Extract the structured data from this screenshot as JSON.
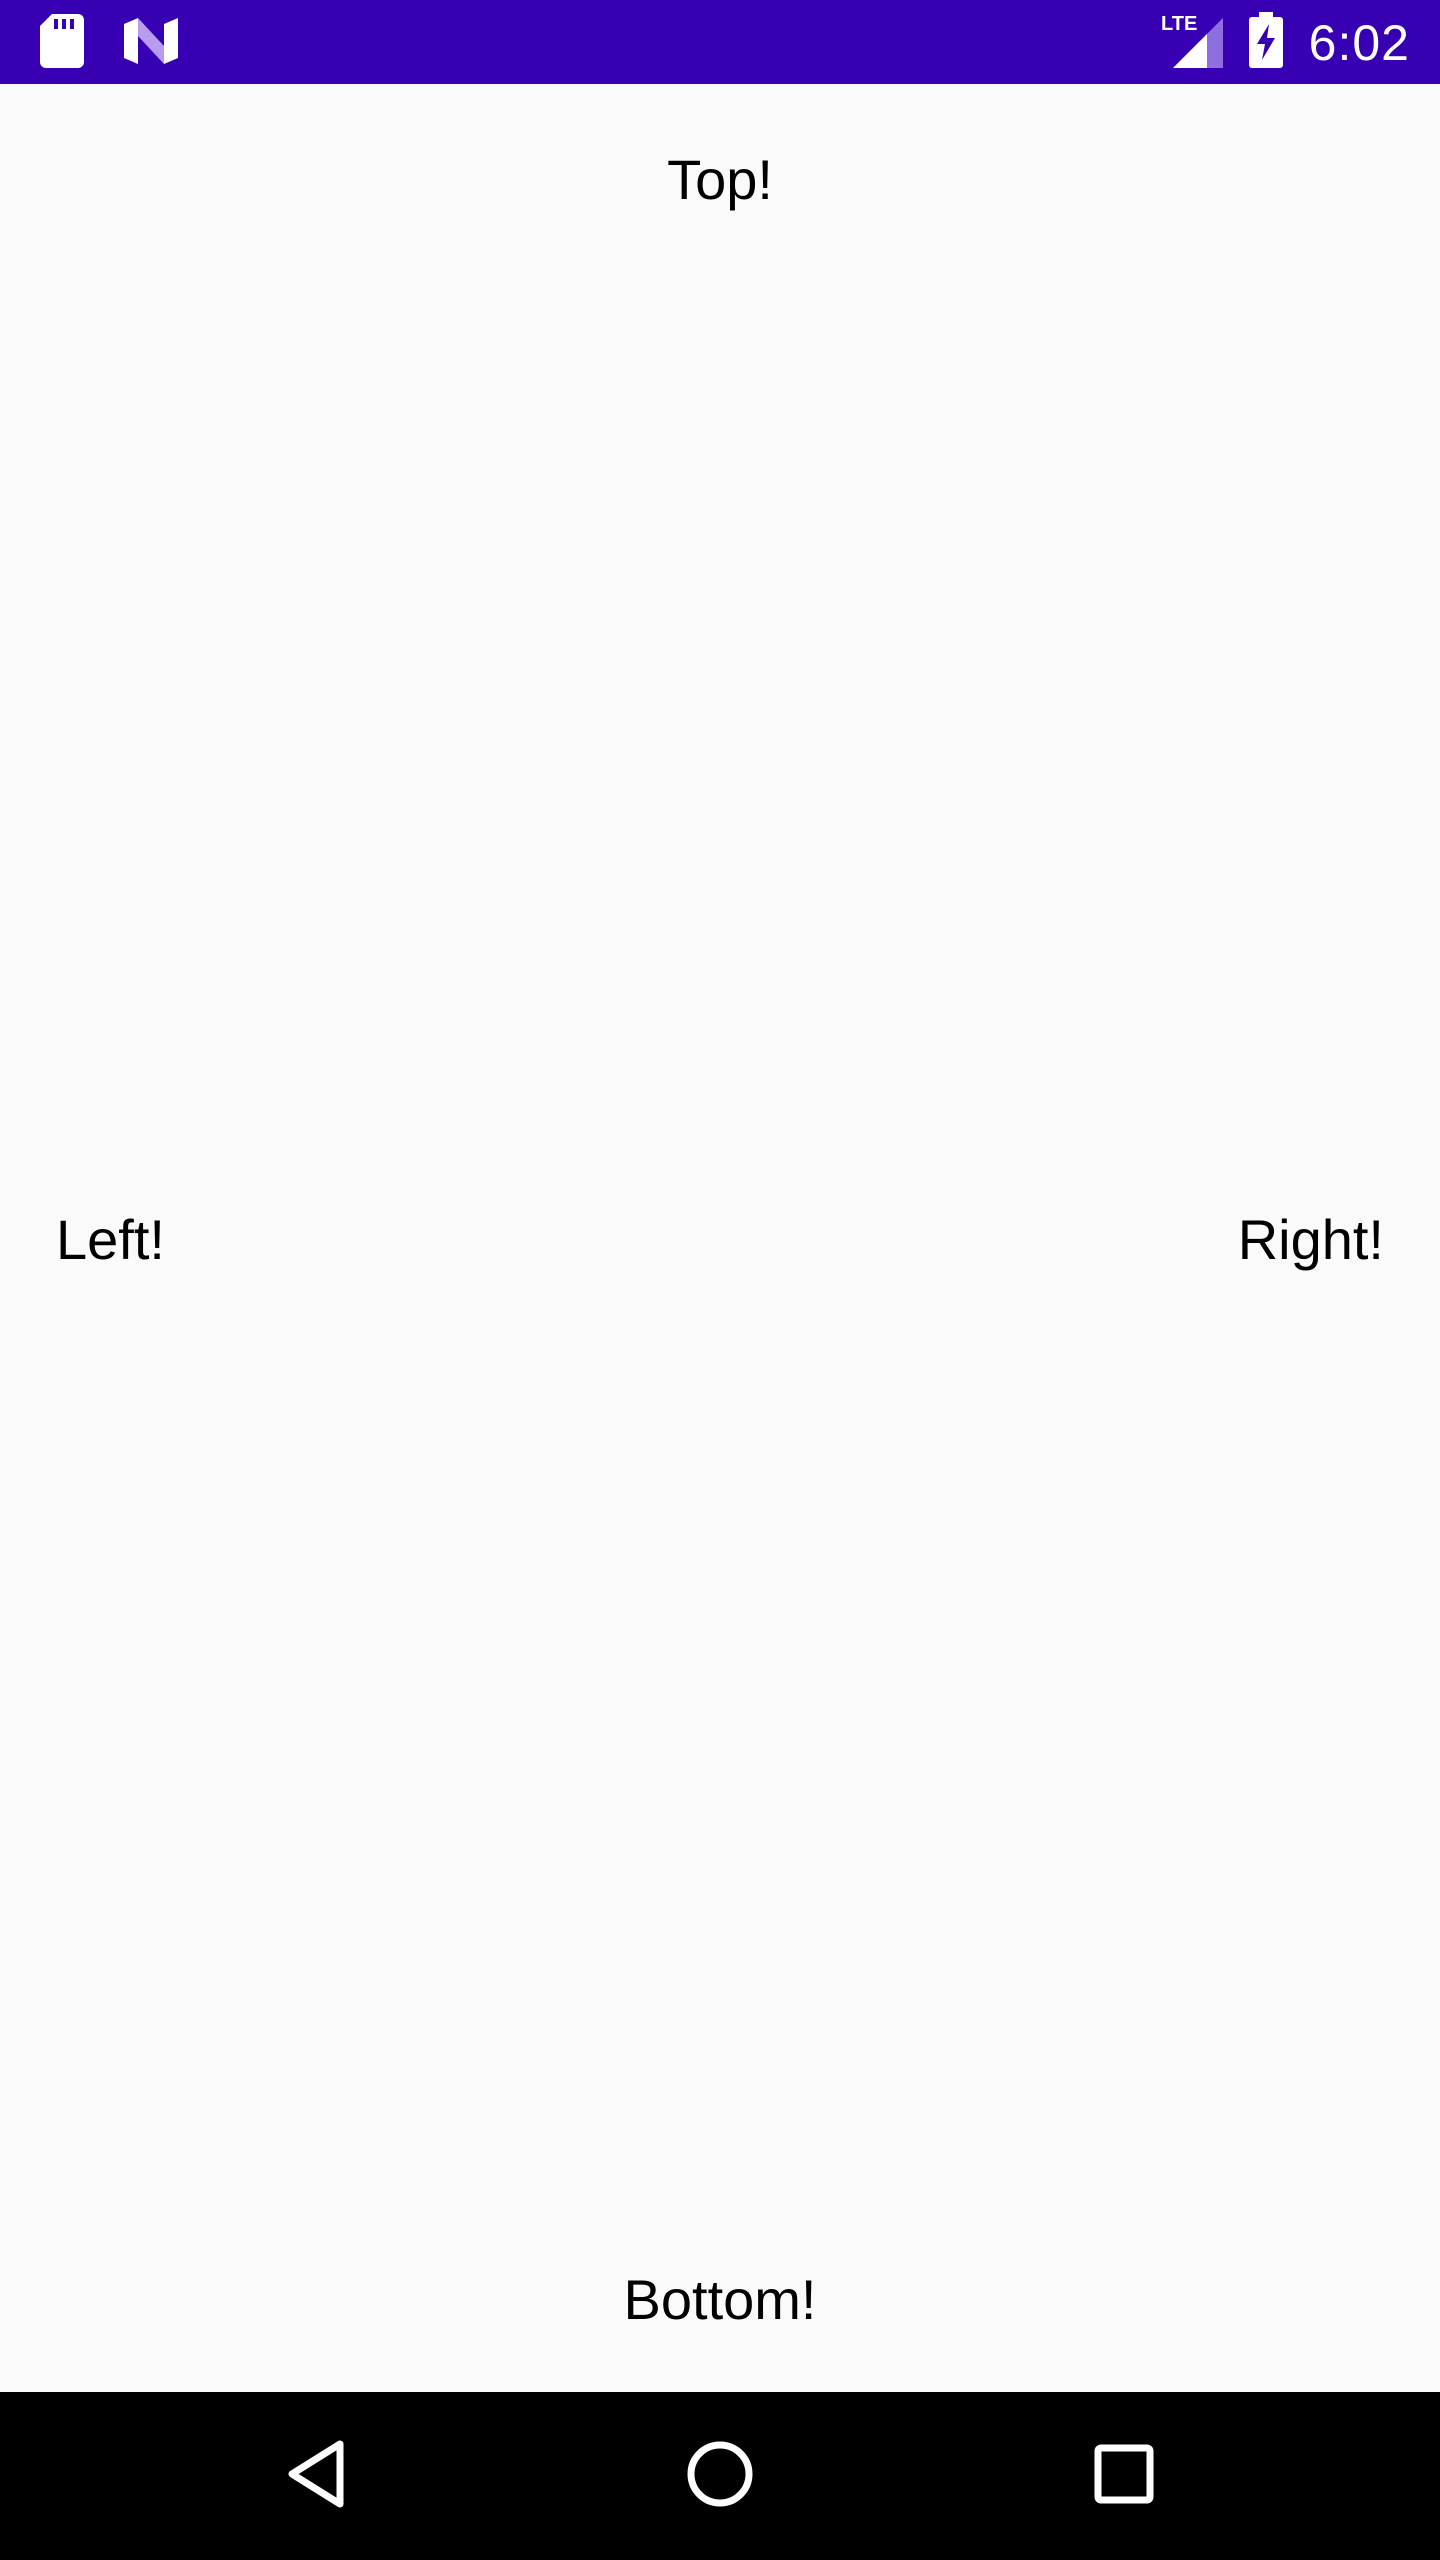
{
  "status_bar": {
    "time": "6:02",
    "network_label": "LTE",
    "background_color": "#3700b3",
    "icons": [
      "sd-card-icon",
      "app-n-icon",
      "lte-signal-icon",
      "battery-charging-icon"
    ]
  },
  "content": {
    "top_label": "Top!",
    "left_label": "Left!",
    "right_label": "Right!",
    "bottom_label": "Bottom!"
  },
  "nav_bar": {
    "icons": [
      "back-icon",
      "home-icon",
      "recents-icon"
    ]
  }
}
